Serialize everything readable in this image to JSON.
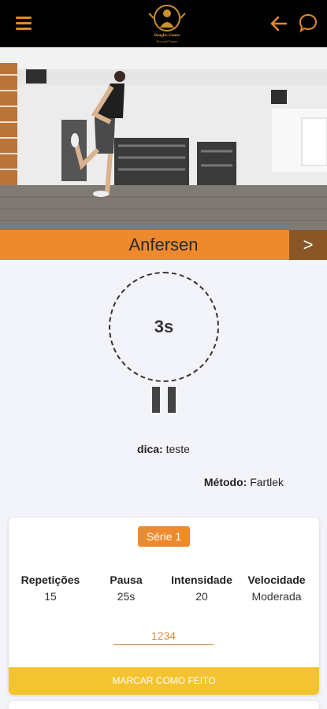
{
  "header": {
    "menu_icon": "hamburger-menu-icon",
    "logo_text": "Douglas Gomes",
    "logo_sub": "Personal Trainer",
    "back_icon": "arrow-left-icon",
    "chat_icon": "chat-bubble-icon",
    "background": "#000000",
    "accent": "#e08a2c"
  },
  "exercise": {
    "title": "Anfersen",
    "next_label": ">"
  },
  "timer": {
    "label": "3s",
    "pause_icon": "pause-icon"
  },
  "tip": {
    "label": "dica:",
    "value": "teste"
  },
  "method": {
    "label": "Método:",
    "value": "Fartlek"
  },
  "set_card": {
    "serie_label": "Série 1",
    "stats": [
      {
        "label": "Repetições",
        "value": "15"
      },
      {
        "label": "Pausa",
        "value": "25s"
      },
      {
        "label": "Intensidade",
        "value": "20"
      },
      {
        "label": "Velocidade",
        "value": "Moderada"
      }
    ],
    "input_placeholder": "1234",
    "done_label": "MARCAR COMO FEITO",
    "accent": "#ee8a2e",
    "done_color": "#f4c430"
  }
}
